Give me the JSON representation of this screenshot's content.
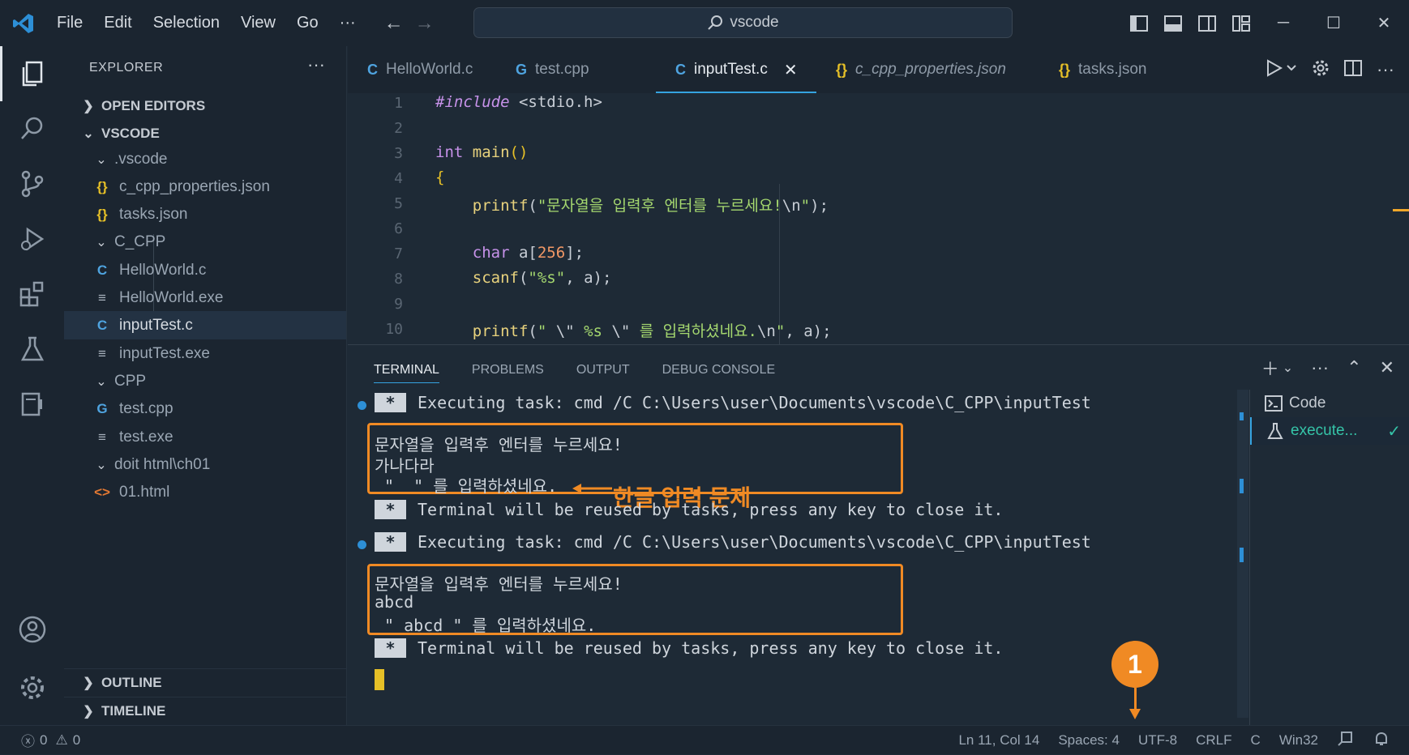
{
  "menu": [
    "File",
    "Edit",
    "Selection",
    "View",
    "Go",
    "···"
  ],
  "search": {
    "label": "vscode"
  },
  "sidebar": {
    "title": "EXPLORER",
    "more": "···",
    "open_editors": "OPEN EDITORS",
    "root": "VSCODE",
    "tree": [
      {
        "label": ".vscode",
        "kind": "folder"
      },
      {
        "label": "c_cpp_properties.json",
        "kind": "json"
      },
      {
        "label": "tasks.json",
        "kind": "json"
      },
      {
        "label": "C_CPP",
        "kind": "folder"
      },
      {
        "label": "HelloWorld.c",
        "kind": "c"
      },
      {
        "label": "HelloWorld.exe",
        "kind": "exe"
      },
      {
        "label": "inputTest.c",
        "kind": "c",
        "selected": true
      },
      {
        "label": "inputTest.exe",
        "kind": "exe"
      },
      {
        "label": "CPP",
        "kind": "folder"
      },
      {
        "label": "test.cpp",
        "kind": "cpp"
      },
      {
        "label": "test.exe",
        "kind": "exe"
      },
      {
        "label": "doit html\\ch01",
        "kind": "folder"
      },
      {
        "label": "01.html",
        "kind": "html"
      }
    ],
    "outline": "OUTLINE",
    "timeline": "TIMELINE"
  },
  "tabs": [
    {
      "label": "HelloWorld.c",
      "icon": "C"
    },
    {
      "label": "test.cpp",
      "icon": "G+"
    },
    {
      "label": "inputTest.c",
      "icon": "C",
      "active": true
    },
    {
      "label": "c_cpp_properties.json",
      "icon": "{}"
    },
    {
      "label": "tasks.json",
      "icon": "{}"
    }
  ],
  "code_lines": [
    {
      "n": "1",
      "text": "#include <stdio.h>"
    },
    {
      "n": "2",
      "text": ""
    },
    {
      "n": "3",
      "text": "int main()"
    },
    {
      "n": "4",
      "text": "{"
    },
    {
      "n": "5",
      "text": "    printf(\"문자열을 입력후 엔터를 누르세요!\\n\");"
    },
    {
      "n": "6",
      "text": ""
    },
    {
      "n": "7",
      "text": "    char a[256];"
    },
    {
      "n": "8",
      "text": "    scanf(\"%s\", a);"
    },
    {
      "n": "9",
      "text": ""
    },
    {
      "n": "10",
      "text": "    printf(\" \\\" %s \\\" 를 입력하셨네요.\\n\", a);"
    }
  ],
  "panel": {
    "tabs": [
      "TERMINAL",
      "PROBLEMS",
      "OUTPUT",
      "DEBUG CONSOLE"
    ],
    "terminal": {
      "star": "*",
      "exec1": "Executing task: cmd /C C:\\Users\\user\\Documents\\vscode\\C_CPP\\inputTest",
      "out1": [
        "문자열을 입력후 엔터를 누르세요!",
        "가나다라",
        " \"  \" 를 입력하셨네요."
      ],
      "reuse1": "Terminal will be reused by tasks, press any key to close it.",
      "exec2": "Executing task: cmd /C C:\\Users\\user\\Documents\\vscode\\C_CPP\\inputTest",
      "out2": [
        "문자열을 입력후 엔터를 누르세요!",
        "abcd",
        " \" abcd \" 를 입력하셨네요."
      ],
      "reuse2": "Terminal will be reused by tasks, press any key to close it.",
      "annotation": "한글 입력 문제"
    },
    "term_list": [
      {
        "label": "Code"
      },
      {
        "label": "execute...",
        "selected": true
      }
    ]
  },
  "status": {
    "errors": "0",
    "warnings": "0",
    "position": "Ln 11, Col 14",
    "spaces": "Spaces: 4",
    "encoding": "UTF-8",
    "eol": "CRLF",
    "language": "C",
    "platform": "Win32"
  },
  "callout": {
    "number": "1"
  },
  "colors": {
    "accent": "#35a3e0",
    "annotation": "#f08a24",
    "background": "#1e2a36"
  }
}
